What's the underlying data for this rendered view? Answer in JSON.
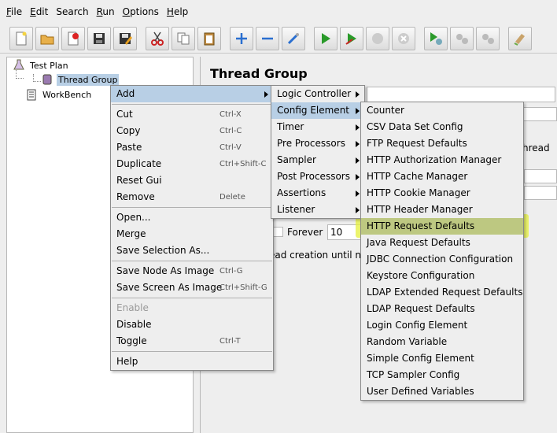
{
  "menubar": [
    {
      "key": "file",
      "letter": "F",
      "rest": "ile"
    },
    {
      "key": "edit",
      "letter": "E",
      "rest": "dit"
    },
    {
      "key": "search",
      "letter": "",
      "rest": "Search"
    },
    {
      "key": "run",
      "letter": "R",
      "rest": "un"
    },
    {
      "key": "options",
      "letter": "O",
      "rest": "ptions"
    },
    {
      "key": "help",
      "letter": "H",
      "rest": "elp"
    }
  ],
  "toolbar": [
    "new-icon",
    "open-icon",
    "close-file-icon",
    "save-icon",
    "save-as-icon",
    "cut-icon",
    "copy-icon",
    "paste-icon",
    "expand-icon",
    "collapse-icon",
    "toggle-icon",
    "start-icon",
    "start-no-pause-icon",
    "stop-icon",
    "shutdown-icon",
    "remote-start-icon",
    "remote-stop-icon",
    "remote-shutdown-icon",
    "clear-icon"
  ],
  "tree": {
    "test_plan": "Test Plan",
    "thread_group": "Thread Group",
    "workbench": "WorkBench"
  },
  "panel": {
    "title": "Thread Group",
    "thread_partial": "hread",
    "forever_label": "Forever",
    "loop_value": "10",
    "creation_text": "ead creation until ne"
  },
  "context_menu": [
    {
      "label": "Add",
      "submenu": true,
      "highlighted": true
    },
    {
      "divider": true
    },
    {
      "label": "Cut",
      "accel": "Ctrl-X"
    },
    {
      "label": "Copy",
      "accel": "Ctrl-C"
    },
    {
      "label": "Paste",
      "accel": "Ctrl-V"
    },
    {
      "label": "Duplicate",
      "accel": "Ctrl+Shift-C"
    },
    {
      "label": "Reset Gui"
    },
    {
      "label": "Remove",
      "accel": "Delete"
    },
    {
      "divider": true
    },
    {
      "label": "Open..."
    },
    {
      "label": "Merge"
    },
    {
      "label": "Save Selection As..."
    },
    {
      "divider": true
    },
    {
      "label": "Save Node As Image",
      "accel": "Ctrl-G"
    },
    {
      "label": "Save Screen As Image",
      "accel": "Ctrl+Shift-G"
    },
    {
      "divider": true
    },
    {
      "label": "Enable",
      "disabled": true
    },
    {
      "label": "Disable"
    },
    {
      "label": "Toggle",
      "accel": "Ctrl-T"
    },
    {
      "divider": true
    },
    {
      "label": "Help"
    }
  ],
  "add_menu": [
    {
      "label": "Logic Controller",
      "submenu": true
    },
    {
      "label": "Config Element",
      "submenu": true,
      "highlighted": true
    },
    {
      "label": "Timer",
      "submenu": true
    },
    {
      "label": "Pre Processors",
      "submenu": true
    },
    {
      "label": "Sampler",
      "submenu": true
    },
    {
      "label": "Post Processors",
      "submenu": true
    },
    {
      "label": "Assertions",
      "submenu": true
    },
    {
      "label": "Listener",
      "submenu": true
    }
  ],
  "config_menu": [
    "Counter",
    "CSV Data Set Config",
    "FTP Request Defaults",
    "HTTP Authorization Manager",
    "HTTP Cache Manager",
    "HTTP Cookie Manager",
    "HTTP Header Manager",
    "HTTP Request Defaults",
    "Java Request Defaults",
    "JDBC Connection Configuration",
    "Keystore Configuration",
    "LDAP Extended Request Defaults",
    "LDAP Request Defaults",
    "Login Config Element",
    "Random Variable",
    "Simple Config Element",
    "TCP Sampler Config",
    "User Defined Variables"
  ],
  "config_highlight_index": 7,
  "colors": {
    "menu_highlight": "#b8cfe5",
    "annotation_yellow": "#e6f03c"
  }
}
